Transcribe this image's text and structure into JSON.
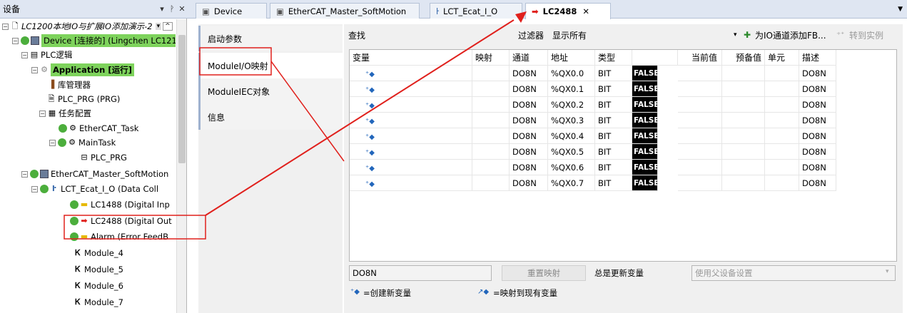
{
  "left_panel": {
    "title": "设备",
    "tree": [
      {
        "label": "LC1200本地IO与扩展IO添加演示-2"
      },
      {
        "label": "Device [连接的] (Lingchen LC121"
      },
      {
        "label": "PLC逻辑"
      },
      {
        "label": "Application [运行]"
      },
      {
        "label": "库管理器"
      },
      {
        "label": "PLC_PRG (PRG)"
      },
      {
        "label": "任务配置"
      },
      {
        "label": "EtherCAT_Task"
      },
      {
        "label": "MainTask"
      },
      {
        "label": "PLC_PRG"
      },
      {
        "label": "EtherCAT_Master_SoftMotion"
      },
      {
        "label": "LCT_Ecat_I_O (Data Coll"
      },
      {
        "label": "LC1488 (Digital Inp"
      },
      {
        "label": "LC2488 (Digital Out"
      },
      {
        "label": "Alarm (Error FeedB"
      },
      {
        "label": "Module_4"
      },
      {
        "label": "Module_5"
      },
      {
        "label": "Module_6"
      },
      {
        "label": "Module_7"
      }
    ]
  },
  "tabs": [
    {
      "label": "Device"
    },
    {
      "label": "EtherCAT_Master_SoftMotion"
    },
    {
      "label": "LCT_Ecat_I_O"
    },
    {
      "label": "LC2488"
    }
  ],
  "side_tabs": [
    {
      "label": "启动参数"
    },
    {
      "label": "ModuleI/O映射"
    },
    {
      "label": "ModuleIEC对象"
    },
    {
      "label": "信息"
    }
  ],
  "toolbar": {
    "find_label": "查找",
    "filter_label": "过滤器",
    "filter_value": "显示所有",
    "add_fb_label": "为IO通道添加FB...",
    "goto_instance_label": "转到实例"
  },
  "grid": {
    "columns": [
      "变量",
      "映射",
      "通道",
      "地址",
      "类型",
      "",
      "当前值",
      "预备值",
      "单元",
      "描述"
    ],
    "rows": [
      {
        "channel": "DO8N",
        "address": "%QX0.0",
        "type": "BIT",
        "value": "FALSE",
        "desc": "DO8N"
      },
      {
        "channel": "DO8N",
        "address": "%QX0.1",
        "type": "BIT",
        "value": "FALSE",
        "desc": "DO8N"
      },
      {
        "channel": "DO8N",
        "address": "%QX0.2",
        "type": "BIT",
        "value": "FALSE",
        "desc": "DO8N"
      },
      {
        "channel": "DO8N",
        "address": "%QX0.3",
        "type": "BIT",
        "value": "FALSE",
        "desc": "DO8N"
      },
      {
        "channel": "DO8N",
        "address": "%QX0.4",
        "type": "BIT",
        "value": "FALSE",
        "desc": "DO8N"
      },
      {
        "channel": "DO8N",
        "address": "%QX0.5",
        "type": "BIT",
        "value": "FALSE",
        "desc": "DO8N"
      },
      {
        "channel": "DO8N",
        "address": "%QX0.6",
        "type": "BIT",
        "value": "FALSE",
        "desc": "DO8N"
      },
      {
        "channel": "DO8N",
        "address": "%QX0.7",
        "type": "BIT",
        "value": "FALSE",
        "desc": "DO8N"
      }
    ]
  },
  "bottom": {
    "selected_field": "DO8N",
    "reset_mapping_label": "重置映射",
    "always_update_label": "总是更新变量",
    "always_update_value": "使用父设备设置",
    "legend_new": "=创建新变量",
    "legend_map": "=映射到现有变量"
  },
  "colors": {
    "highlight": "#7ed35c",
    "annotation": "#e0201c",
    "value_bg": "#000000"
  }
}
